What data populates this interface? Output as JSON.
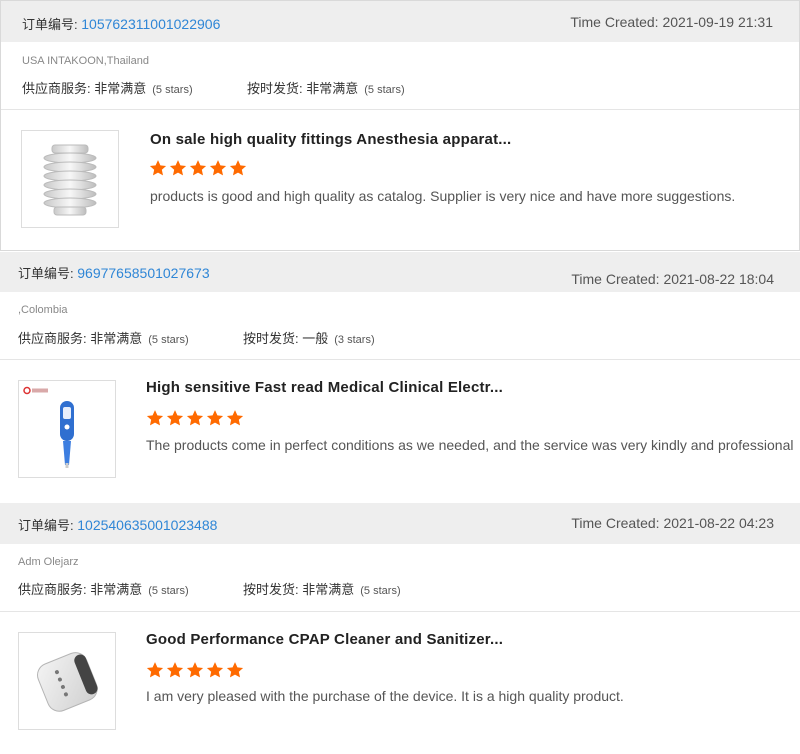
{
  "colors": {
    "accent": "#2f86d6",
    "star": "#ff6a00",
    "header_bg": "#eeeeee"
  },
  "labels": {
    "order_no": "订单编号:",
    "supplier_service": "供应商服务:",
    "on_time_shipping": "按时发货:",
    "time_created": "Time Created:"
  },
  "orders": [
    {
      "order_id": "105762311001022906",
      "time_created": "2021-09-19 21:31",
      "buyer": "USA INTAKOON,Thailand",
      "supplier_service_value": "非常满意",
      "supplier_service_stars": "(5 stars)",
      "shipping_value": "非常满意",
      "shipping_stars": "(5 stars)",
      "product_title": "On sale high quality fittings Anesthesia apparat...",
      "rating": 5,
      "review": "products is good and high quality as catalog. Supplier is very nice and have more suggestions.",
      "thumb_icon": "bellows-fitting-icon"
    },
    {
      "order_id": "96977658501027673",
      "time_created": "2021-08-22 18:04",
      "buyer": ",Colombia",
      "supplier_service_value": "非常满意",
      "supplier_service_stars": "(5 stars)",
      "shipping_value": "一般",
      "shipping_stars": "(3 stars)",
      "product_title": "High sensitive Fast read Medical Clinical Electr...",
      "rating": 5,
      "review": "The products come in perfect conditions as we needed, and the service was very kindly and professional",
      "thumb_icon": "thermometer-icon"
    },
    {
      "order_id": "102540635001023488",
      "time_created": "2021-08-22 04:23",
      "buyer": "Adm Olejarz",
      "supplier_service_value": "非常满意",
      "supplier_service_stars": "(5 stars)",
      "shipping_value": "非常满意",
      "shipping_stars": "(5 stars)",
      "product_title": "Good Performance CPAP Cleaner and Sanitizer...",
      "rating": 5,
      "review": "I am very pleased with the purchase of the device. It is a high quality product.",
      "thumb_icon": "cpap-cleaner-icon"
    }
  ]
}
